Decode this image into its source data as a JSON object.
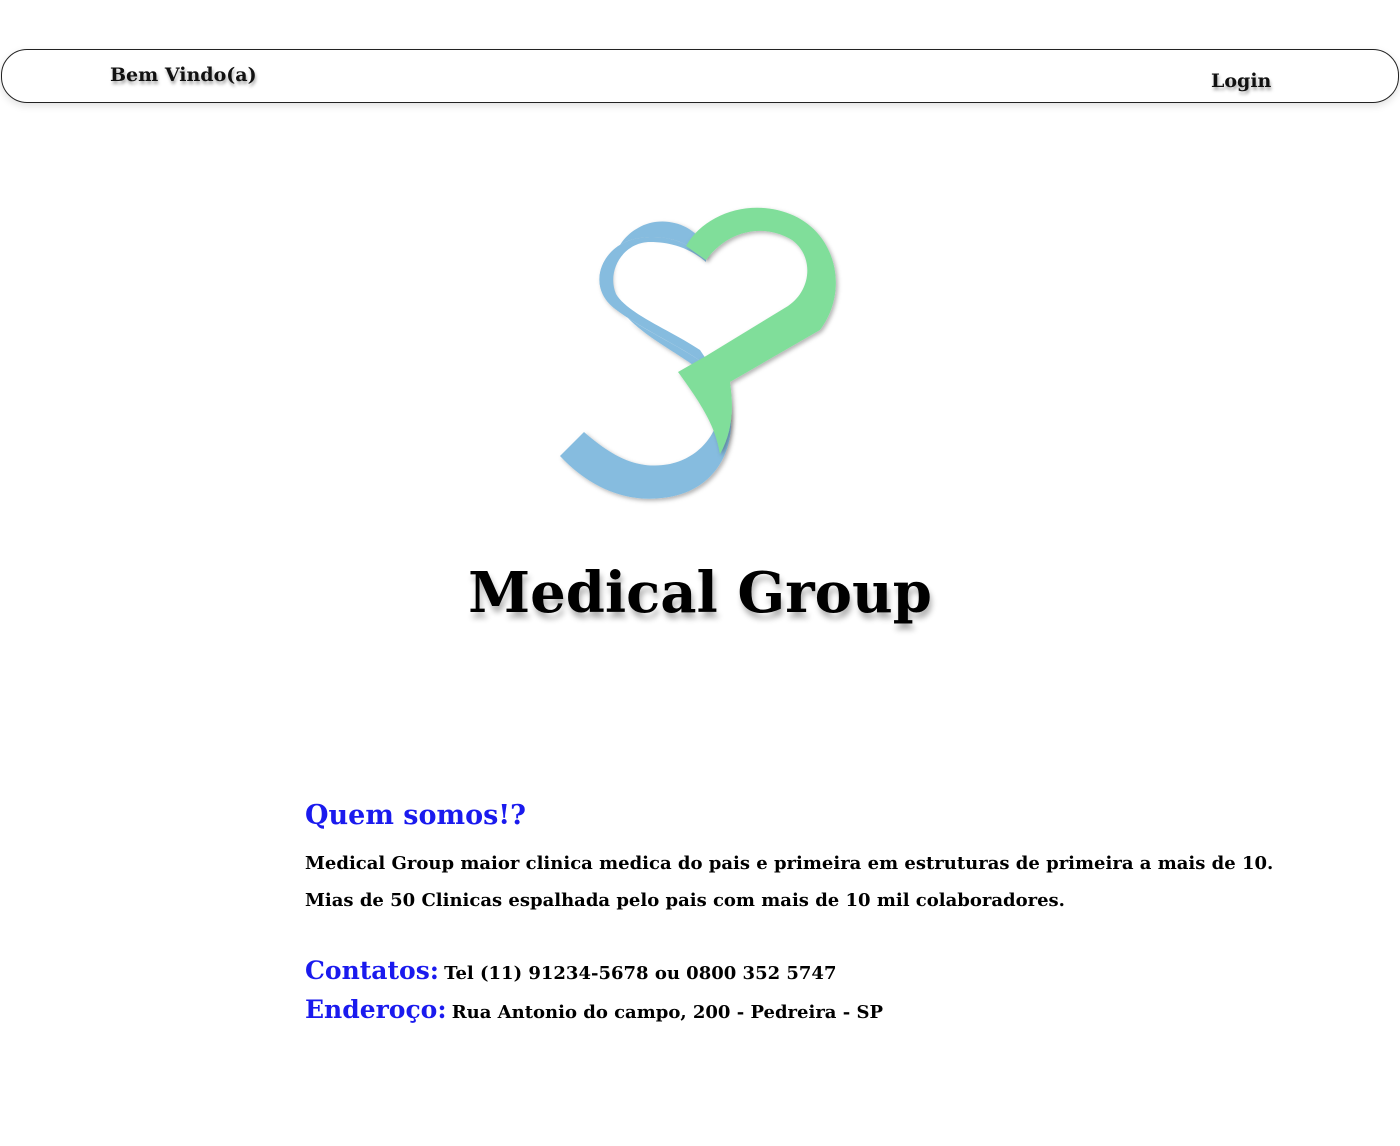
{
  "header": {
    "welcome": "Bem Vindo(a)",
    "login": "Login"
  },
  "brand": {
    "logo_icon": "heart-s-logo-icon",
    "title": "Medical Group",
    "colors": {
      "blue": "#86BCDF",
      "green": "#80DE9A"
    }
  },
  "about": {
    "heading": "Quem somos!?",
    "paragraphs": [
      "Medical Group maior clinica medica do pais e primeira em estruturas de primeira a mais de 10.",
      "Mias de 50 Clinicas espalhada pelo pais com mais de 10 mil colaboradores."
    ]
  },
  "contacts": {
    "phone_label": "Contatos:",
    "phone_value": "Tel (11) 91234-5678 ou 0800 352 5747",
    "address_label": "Enderoço:",
    "address_value": "Rua Antonio do campo, 200 - Pedreira  - SP"
  },
  "colors": {
    "heading_blue": "#1A1AEE",
    "text": "#000000"
  }
}
